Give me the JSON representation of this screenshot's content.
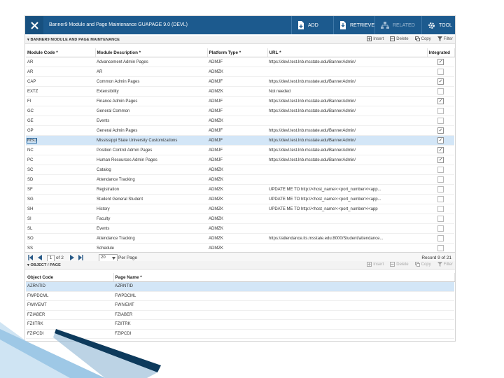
{
  "header": {
    "title": "Banner9 Module and Page Maintenance GUAPAGE 9.0 (DEVL)",
    "add": "ADD",
    "retrieve": "RETRIEVE",
    "related": "RELATED",
    "tools": "TOOL"
  },
  "section1": {
    "title": "▾ BANNER9 MODULE AND PAGE MAINTENANCE",
    "insert": "Insert",
    "delete": "Delete",
    "copy": "Copy",
    "filter": "Filter"
  },
  "module_table": {
    "headers": {
      "code": "Module Code *",
      "desc": "Module Description *",
      "platform": "Platform Type *",
      "url": "URL *",
      "integrated": "Integrated"
    },
    "rows": [
      {
        "code": "AR",
        "desc": "Advancement Admin Pages",
        "platform": "ADMJF",
        "url": "https://devl.test.lnb.msstate.edu/BannerAdmin/",
        "integrated": true
      },
      {
        "code": "AR",
        "desc": "AR",
        "platform": "ADMZK",
        "url": "",
        "integrated": false
      },
      {
        "code": "CAP",
        "desc": "Common Admin Pages",
        "platform": "ADMJF",
        "url": "https://devl.test.lnb.msstate.edu/BannerAdmin/",
        "integrated": true
      },
      {
        "code": "EXTZ",
        "desc": "Extensibility",
        "platform": "ADMZK",
        "url": "Not needed",
        "integrated": false
      },
      {
        "code": "FI",
        "desc": "Finance Admin Pages",
        "platform": "ADMJF",
        "url": "https://devl.test.lnb.msstate.edu/BannerAdmin/",
        "integrated": true
      },
      {
        "code": "GC",
        "desc": "General Common",
        "platform": "ADMJF",
        "url": "https://devl.test.lnb.msstate.edu/BannerAdmin/",
        "integrated": false
      },
      {
        "code": "GE",
        "desc": "Events",
        "platform": "ADMZK",
        "url": "",
        "integrated": false
      },
      {
        "code": "GP",
        "desc": "General Admin Pages",
        "platform": "ADMJF",
        "url": "https://devl.test.lnb.msstate.edu/BannerAdmin/",
        "integrated": true
      },
      {
        "code": "MSU",
        "desc": "Mississippi State University Customizations",
        "platform": "ADMJF",
        "url": "https://devl.test.lnb.msstate.edu/BannerAdmin/",
        "integrated": true
      },
      {
        "code": "NC",
        "desc": "Position Control Admin Pages",
        "platform": "ADMJF",
        "url": "https://devl.test.lnb.msstate.edu/BannerAdmin/",
        "integrated": true
      },
      {
        "code": "PC",
        "desc": "Human Resources Admin Pages",
        "platform": "ADMJF",
        "url": "https://devl.test.lnb.msstate.edu/BannerAdmin/",
        "integrated": true
      },
      {
        "code": "SC",
        "desc": "Catalog",
        "platform": "ADMZK",
        "url": "",
        "integrated": false
      },
      {
        "code": "SD",
        "desc": "Attendance Tracking",
        "platform": "ADMZK",
        "url": "",
        "integrated": false
      },
      {
        "code": "SF",
        "desc": "Registration",
        "platform": "ADMZK",
        "url": "UPDATE ME TO http://<host_name>:<port_number>/<app...",
        "integrated": false
      },
      {
        "code": "SG",
        "desc": "Student General Student",
        "platform": "ADMZK",
        "url": "UPDATE ME TO http://<host_name>:<port_number>/<app...",
        "integrated": false
      },
      {
        "code": "SH",
        "desc": "History",
        "platform": "ADMZK",
        "url": "UPDATE ME TO http://<host_name>:<port_number>/<app",
        "integrated": false
      },
      {
        "code": "SI",
        "desc": "Faculty",
        "platform": "ADMZK",
        "url": "",
        "integrated": false
      },
      {
        "code": "SL",
        "desc": "Events",
        "platform": "ADMZK",
        "url": "",
        "integrated": false
      },
      {
        "code": "SO",
        "desc": "Attendance Tracking",
        "platform": "ADMZK",
        "url": "https://attendance.its.msstate.edu:8000/Student/attendance...",
        "integrated": false
      },
      {
        "code": "SS",
        "desc": "Schedule",
        "platform": "ADMZK",
        "url": "",
        "integrated": false
      }
    ],
    "selected_row": "MSU"
  },
  "pager": {
    "page": "1",
    "of": "of 2",
    "per_page_value": "20",
    "per_page_label": "Per Page",
    "record": "Record 9 of 21"
  },
  "section2": {
    "title": "▾ OBJECT / PAGE",
    "insert": "Insert",
    "delete": "Delete",
    "copy": "Copy",
    "filter": "Filter"
  },
  "object_table": {
    "headers": {
      "object": "Object Code",
      "page": "Page Name *"
    },
    "rows": [
      {
        "object": "AZRNTID",
        "page": "AZRNTID"
      },
      {
        "object": "FWPDCML",
        "page": "FWPDCML"
      },
      {
        "object": "FWIVEMT",
        "page": "FWIVEMT"
      },
      {
        "object": "FZIABER",
        "page": "FZIABER"
      },
      {
        "object": "FZIITRK",
        "page": "FZIITRK"
      },
      {
        "object": "FZIPCDI",
        "page": "FZIPCDI"
      }
    ],
    "selected_row": "AZRNTID"
  },
  "colors": {
    "header_bg": "#1c5a8e",
    "selected_row": "#d3e6f7",
    "deco_arrow_dark": "#0d3a5c",
    "deco_arrow_light": "#9ec8e6"
  }
}
